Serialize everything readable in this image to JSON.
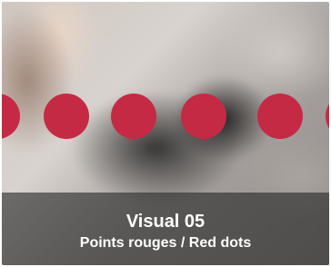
{
  "card": {
    "title": "Visual 05",
    "subtitle": "Points rouges / Red dots",
    "dot_color": "#c52a44",
    "dot_count": 5
  }
}
